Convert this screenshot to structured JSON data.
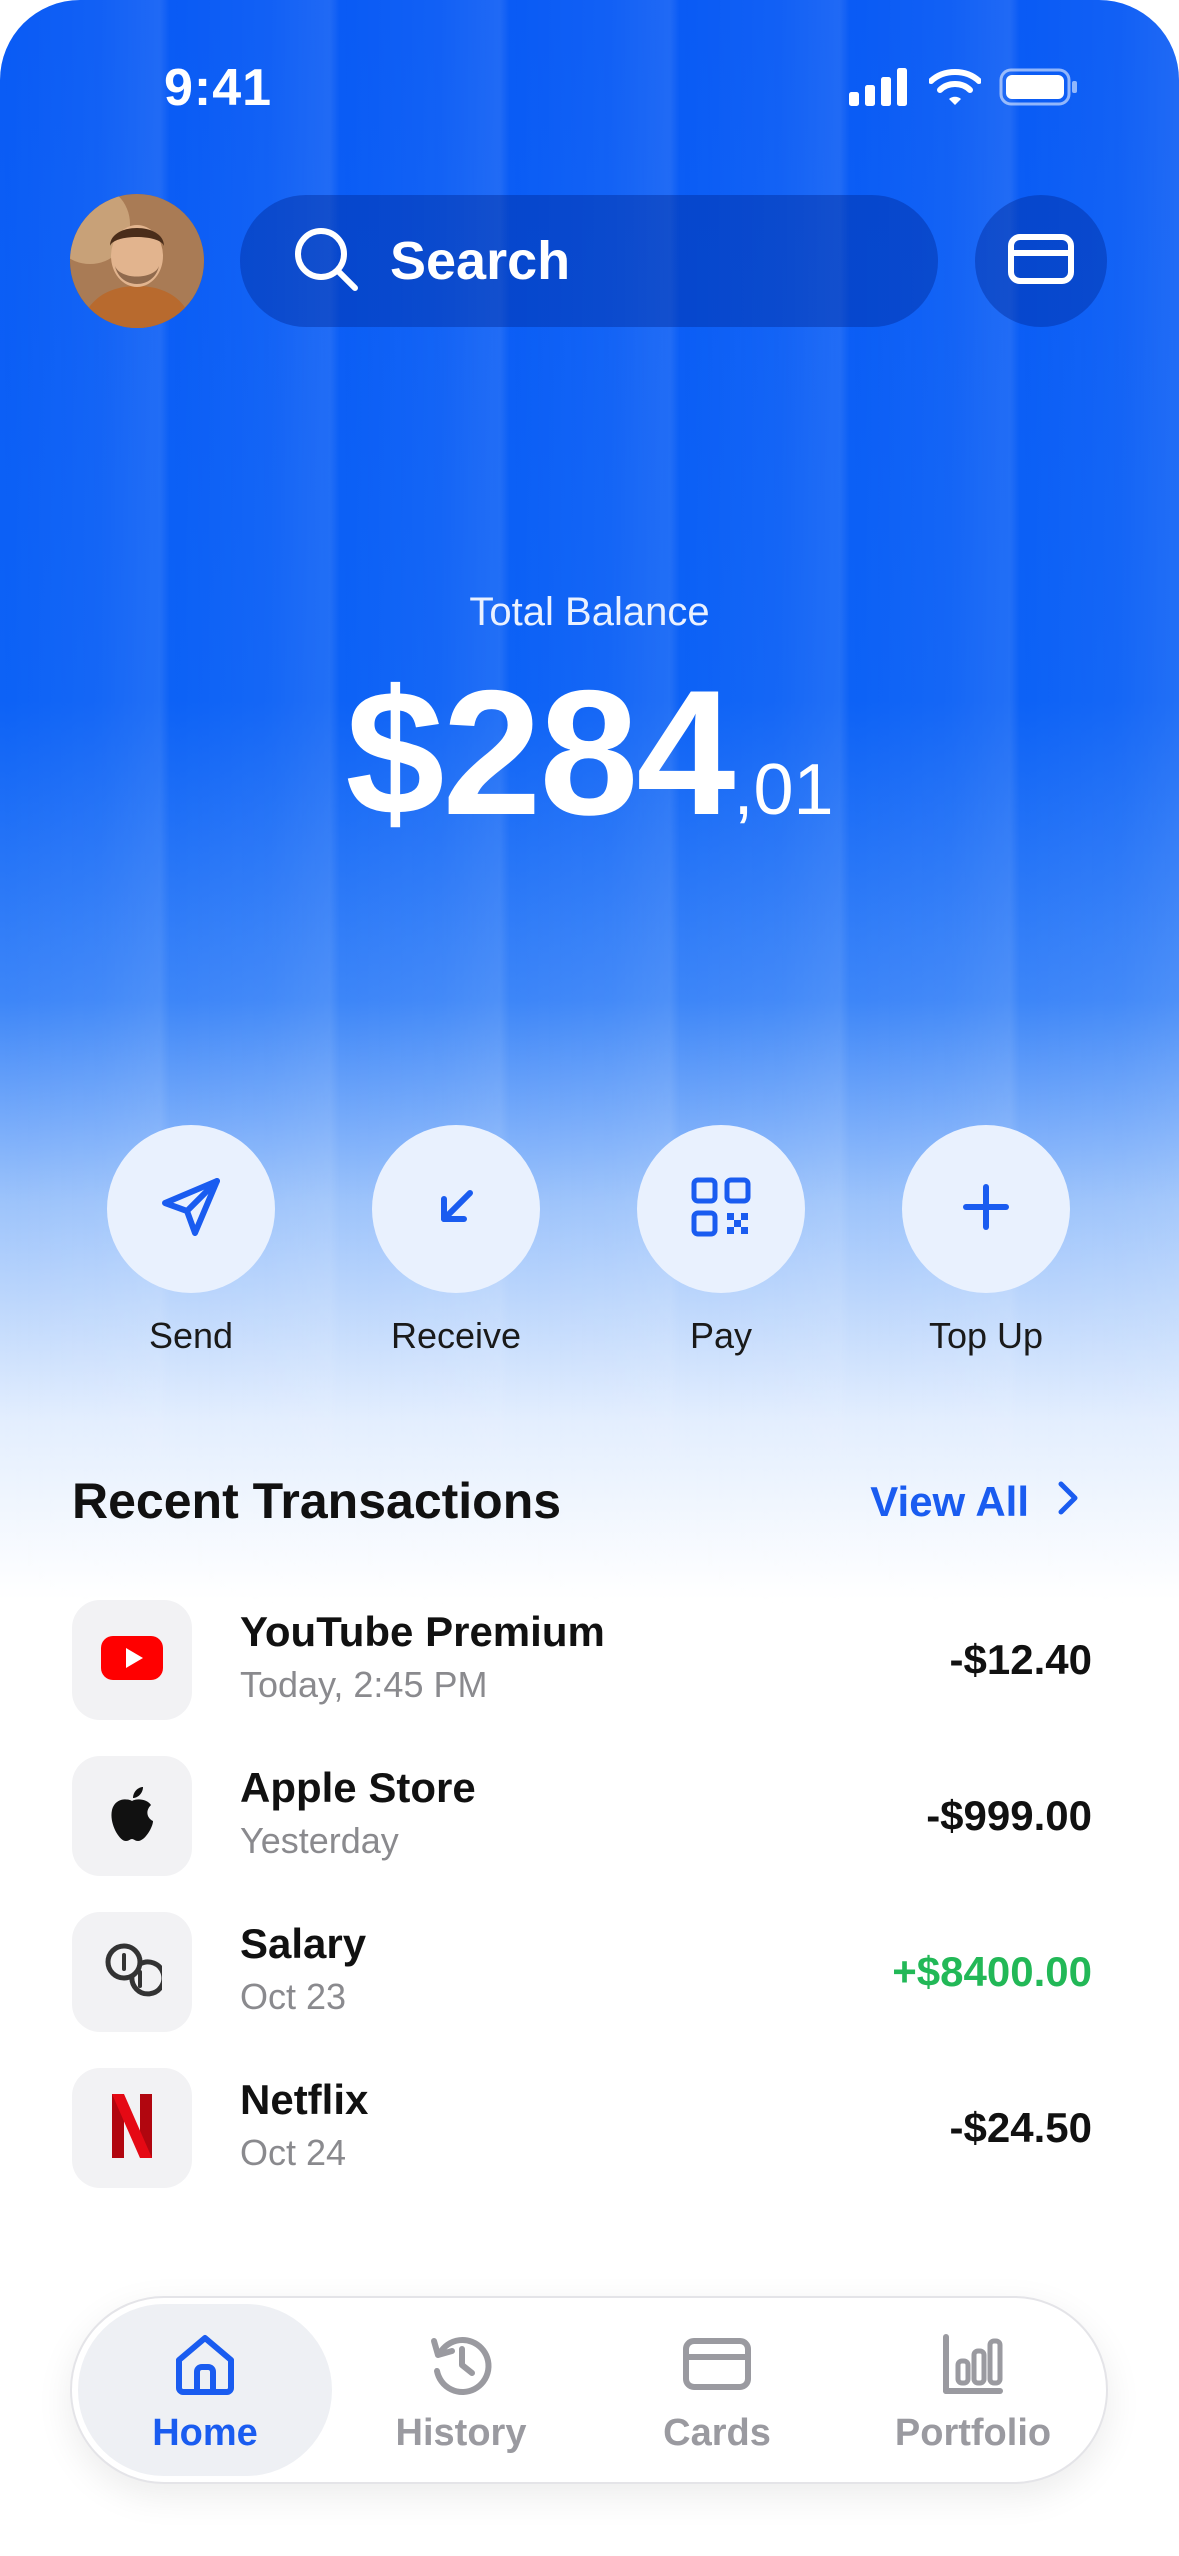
{
  "status_bar": {
    "time": "9:41"
  },
  "header": {
    "search_placeholder": "Search",
    "icons": {
      "search": "search-icon",
      "card": "credit-card-icon",
      "avatar": "user-avatar"
    }
  },
  "balance": {
    "label": "Total Balance",
    "main": "$284",
    "cents": ",01"
  },
  "actions": [
    {
      "label": "Send",
      "icon": "send-icon"
    },
    {
      "label": "Receive",
      "icon": "arrow-down-left-icon"
    },
    {
      "label": "Pay",
      "icon": "qr-code-icon"
    },
    {
      "label": "Top Up",
      "icon": "plus-icon"
    }
  ],
  "transactions": {
    "title": "Recent Transactions",
    "view_all": "View All",
    "items": [
      {
        "name": "YouTube Premium",
        "date": "Today, 2:45 PM",
        "amount": "-$12.40",
        "icon": "youtube-icon",
        "type": "debit"
      },
      {
        "name": "Apple Store",
        "date": "Yesterday",
        "amount": "-$999.00",
        "icon": "apple-icon",
        "type": "debit"
      },
      {
        "name": "Salary",
        "date": "Oct 23",
        "amount": "+$8400.00",
        "icon": "coins-icon",
        "type": "credit"
      },
      {
        "name": "Netflix",
        "date": "Oct 24",
        "amount": "-$24.50",
        "icon": "netflix-icon",
        "type": "debit"
      }
    ]
  },
  "tab_bar": {
    "tabs": [
      {
        "label": "Home",
        "icon": "home-icon",
        "active": true
      },
      {
        "label": "History",
        "icon": "history-icon",
        "active": false
      },
      {
        "label": "Cards",
        "icon": "credit-card-icon",
        "active": false
      },
      {
        "label": "Portfolio",
        "icon": "bar-chart-icon",
        "active": false
      }
    ]
  },
  "colors": {
    "primary": "#0a5bf5",
    "accent_text": "#1a5cf0",
    "positive": "#22b857",
    "muted": "#8a8a8e"
  }
}
